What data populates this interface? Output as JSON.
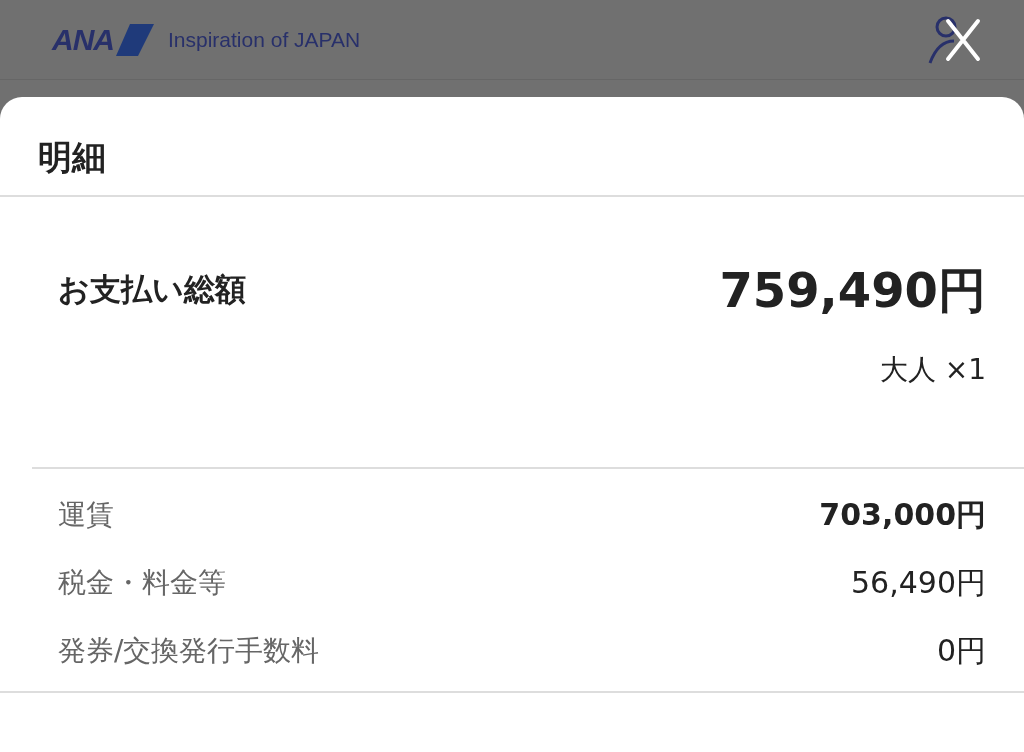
{
  "header": {
    "logo": "ANA",
    "tagline": "Inspiration of JAPAN"
  },
  "sheet": {
    "title": "明細",
    "total": {
      "label": "お支払い総額",
      "amount": "759,490円",
      "passengers": "大人 ×1"
    },
    "rows": [
      {
        "label": "運賃",
        "amount": "703,000円",
        "emphasized": true
      },
      {
        "label": "税金・料金等",
        "amount": "56,490円",
        "emphasized": false
      },
      {
        "label": "発券/交換発行手数料",
        "amount": "0円",
        "emphasized": false
      }
    ]
  }
}
